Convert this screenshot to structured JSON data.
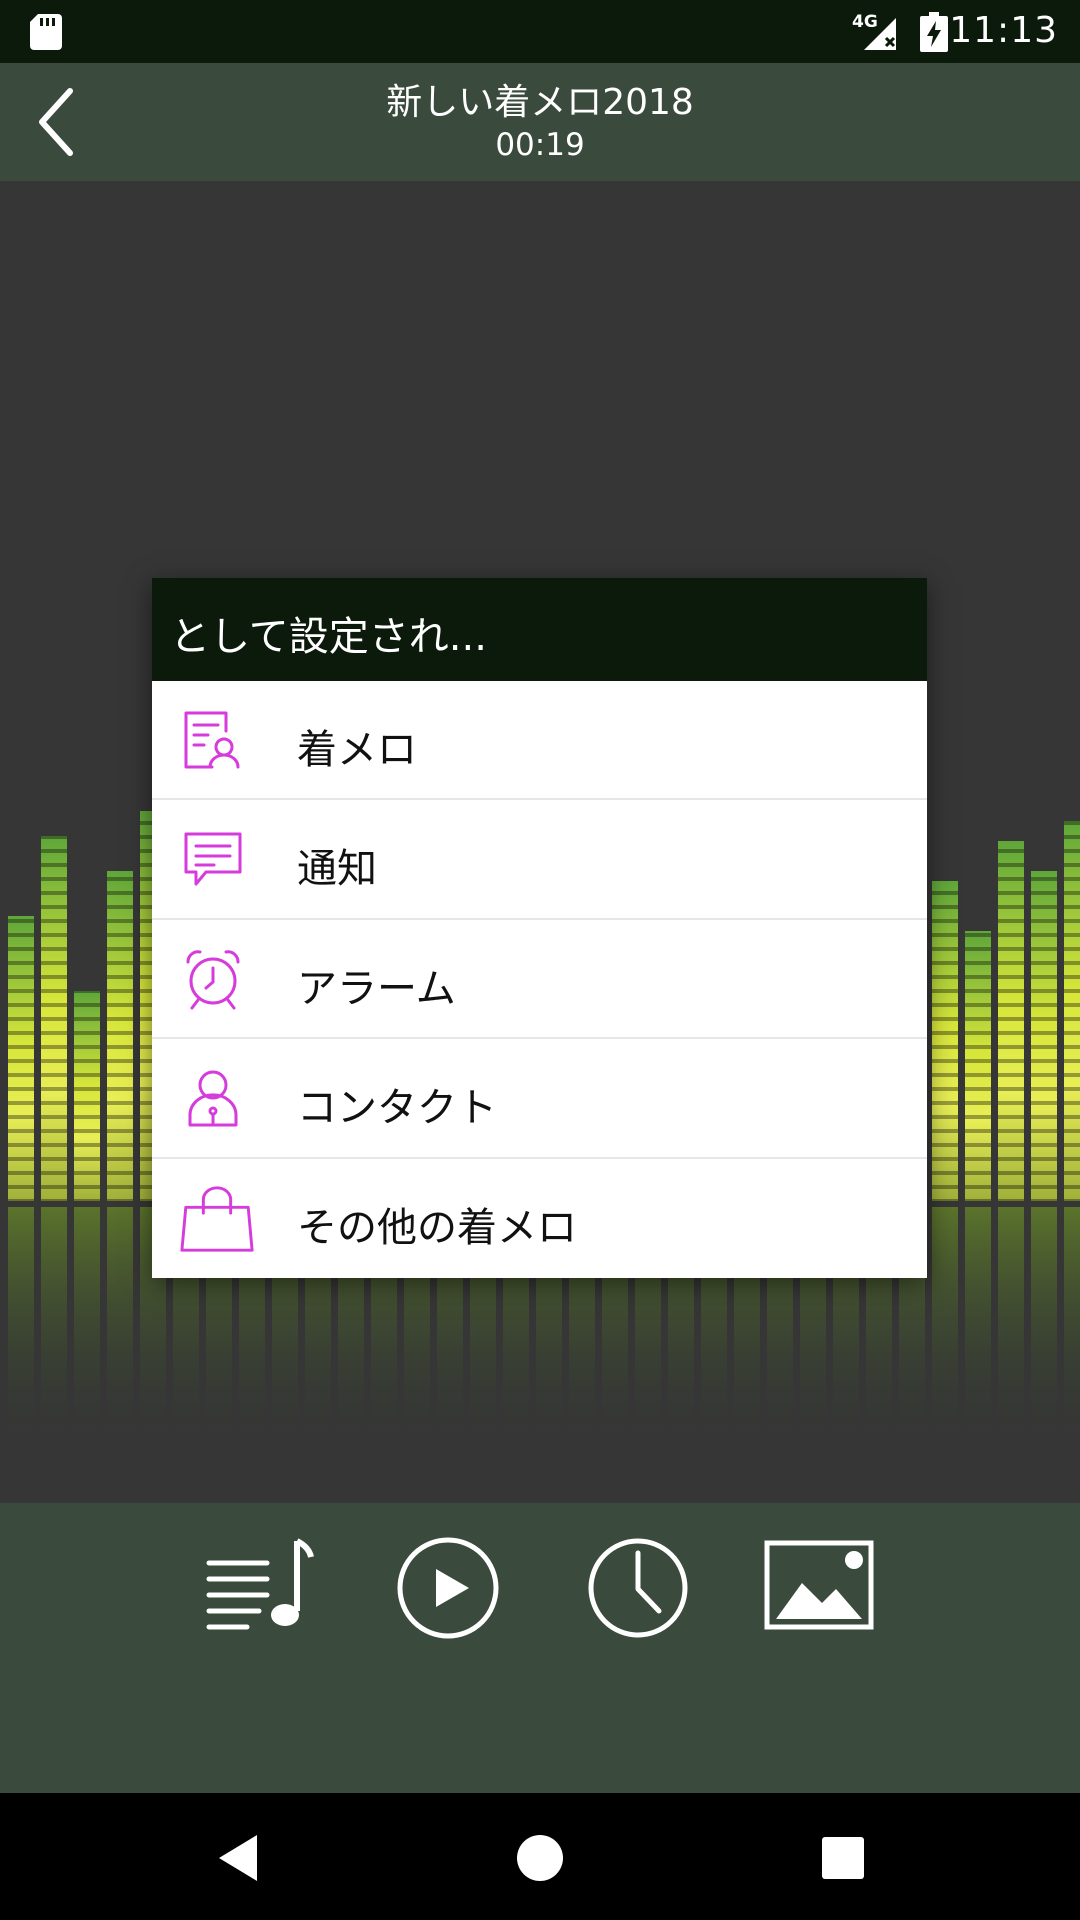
{
  "status_bar": {
    "network": "4G",
    "time": "11:13",
    "icons": [
      "sd-card-icon",
      "signal-icon",
      "battery-charging-icon"
    ]
  },
  "header": {
    "title": "新しい着メロ2018",
    "duration": "00:19",
    "back_icon": "back-chevron-icon"
  },
  "dialog": {
    "title": "として設定され...",
    "items": [
      {
        "label": "着メロ",
        "icon": "ringtone-icon"
      },
      {
        "label": "通知",
        "icon": "notification-icon"
      },
      {
        "label": "アラーム",
        "icon": "alarm-clock-icon"
      },
      {
        "label": "コンタクト",
        "icon": "contact-icon"
      },
      {
        "label": "その他の着メロ",
        "icon": "shopping-bag-icon"
      }
    ]
  },
  "toolbar": {
    "buttons": [
      "playlist-icon",
      "play-icon",
      "clock-icon",
      "image-icon"
    ]
  },
  "nav": {
    "buttons": [
      "back-triangle-icon",
      "home-circle-icon",
      "recents-square-icon"
    ]
  },
  "colors": {
    "accent": "#d63bdc",
    "header_bg": "#3a4a3c",
    "status_bg": "#0b1a0b",
    "main_bg": "#363636"
  }
}
